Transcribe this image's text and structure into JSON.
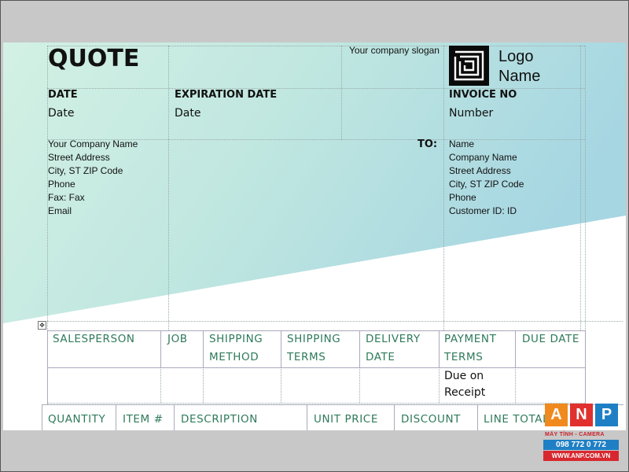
{
  "document": {
    "title": "QUOTE",
    "slogan": "Your company slogan",
    "logo": {
      "icon": "maze-logo-icon",
      "line1": "Logo",
      "line2": "Name"
    },
    "date": {
      "label": "DATE",
      "value": "Date"
    },
    "expiration": {
      "label": "EXPIRATION DATE",
      "value": "Date"
    },
    "invoice": {
      "label": "INVOICE NO",
      "value": "Number"
    },
    "from": [
      "Your Company Name",
      "Street Address",
      "City, ST ZIP Code",
      "Phone",
      "Fax: Fax",
      "Email"
    ],
    "to_label": "TO:",
    "to": [
      "Name",
      "Company Name",
      "Street Address",
      "City, ST ZIP Code",
      "Phone",
      "Customer ID: ID"
    ],
    "details_headers": {
      "salesperson": "SALESPERSON",
      "job": "JOB",
      "shipping_method": [
        "SHIPPING",
        "METHOD"
      ],
      "shipping_terms": [
        "SHIPPING",
        "TERMS"
      ],
      "delivery_date": [
        "DELIVERY",
        "DATE"
      ],
      "payment_terms": [
        "PAYMENT",
        "TERMS"
      ],
      "due_date": "DUE DATE"
    },
    "details_values": {
      "payment_terms": [
        "Due on",
        "Receipt"
      ]
    },
    "items_headers": [
      "QUANTITY",
      "ITEM #",
      "DESCRIPTION",
      "UNIT PRICE",
      "DISCOUNT",
      "LINE TOTAL"
    ]
  },
  "watermark": {
    "letters": [
      "A",
      "N",
      "P"
    ],
    "line1": "MÁY TÍNH - CAMERA",
    "phone": "098 772 0 772",
    "site": "WWW.ANP.COM.VN"
  },
  "colors": {
    "gradient_start": "#ccefe2",
    "gradient_end": "#a8d8e2",
    "header_green": "#2e7a5a",
    "anp_orange": "#f18a1e",
    "anp_red": "#d8282f",
    "anp_blue": "#1f7fc4"
  }
}
